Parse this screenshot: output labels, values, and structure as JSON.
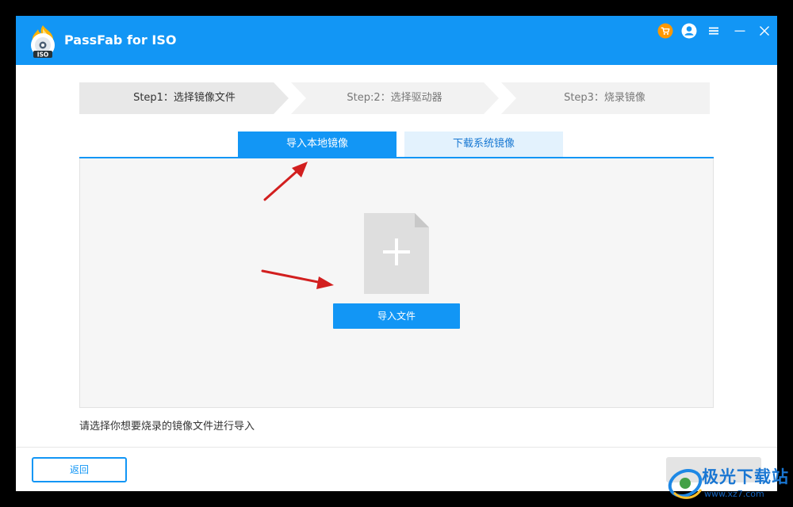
{
  "window": {
    "title": "PassFab for ISO",
    "logo_text": "ISO",
    "accent_color": "#1296f5",
    "titlebar_icons": [
      "cart-icon",
      "user-icon",
      "menu-icon",
      "minimize-icon",
      "close-icon"
    ]
  },
  "steps": [
    {
      "label": "Step1：选择镜像文件",
      "state": "active"
    },
    {
      "label": "Step:2：选择驱动器",
      "state": "inactive"
    },
    {
      "label": "Step3：烧录镜像",
      "state": "inactive"
    }
  ],
  "tabs": [
    {
      "label": "导入本地镜像",
      "selected": true
    },
    {
      "label": "下载系统镜像",
      "selected": false
    }
  ],
  "import_panel": {
    "icon": "file-add-icon",
    "button_label": "导入文件"
  },
  "hint": "请选择你想要烧录的镜像文件进行导入",
  "footer": {
    "back_label": "返回"
  },
  "watermark": {
    "text": "极光下载站",
    "url": "www.xz7.com"
  }
}
